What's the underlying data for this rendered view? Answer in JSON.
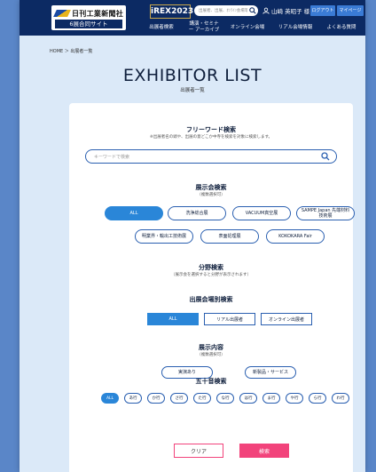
{
  "header": {
    "logo_name": "日刊工業新聞社",
    "logo_sub": "6展合同サイト",
    "event_badge": "iREX2023",
    "search_placeholder": "出展者、出展、ｵﾝﾗｲﾝ会場等",
    "user_name": "山崎 英昭子 様",
    "logout_label": "ログアウト",
    "mypage_label": "マイページ",
    "nav": [
      "出展者検索",
      "講演・セミナー アーカイブ",
      "オンライン会場",
      "リアル会場情報",
      "よくある質問"
    ]
  },
  "breadcrumb": "HOME ＞ 出展者一覧",
  "page_title": "EXHIBITOR LIST",
  "page_subtitle": "出展者一覧",
  "freeword": {
    "title": "フリーワード検索",
    "note": "※出展者名の頭や、出展の意どこか中寺を検索を対象に検索します。",
    "placeholder": "キーワードで検索"
  },
  "exhibition": {
    "title": "展示会検索",
    "note": "（複数選択可）",
    "options": [
      "ALL",
      "洗浄総合展",
      "VACUUM真空展",
      "SAMPE Japan 先端材料技術展",
      "明業界・輸出工技術展",
      "表面処理展",
      "KOKOKARA Fair"
    ],
    "active": "ALL"
  },
  "field": {
    "title": "分野検索",
    "note": "（展示会を選択すると分野が表示されます）"
  },
  "venue": {
    "title": "出展会場別検索",
    "options": [
      "ALL",
      "リアル出展者",
      "オンライン出展者"
    ],
    "active": "ALL"
  },
  "content": {
    "title": "展示内容",
    "note": "（複数選択可）",
    "options": [
      "実演あり",
      "新製品・サービス"
    ]
  },
  "kana": {
    "title": "五十音検索",
    "options": [
      "ALL",
      "あ行",
      "か行",
      "さ行",
      "た行",
      "な行",
      "は行",
      "ま行",
      "や行",
      "ら行",
      "わ行"
    ],
    "active": "ALL"
  },
  "actions": {
    "clear_label": "クリア",
    "search_label": "検索"
  },
  "colors": {
    "header_bg": "#0c2a63",
    "accent": "#2a86d8",
    "search_button": "#f2437b",
    "page_bg": "#dbe9f8"
  }
}
